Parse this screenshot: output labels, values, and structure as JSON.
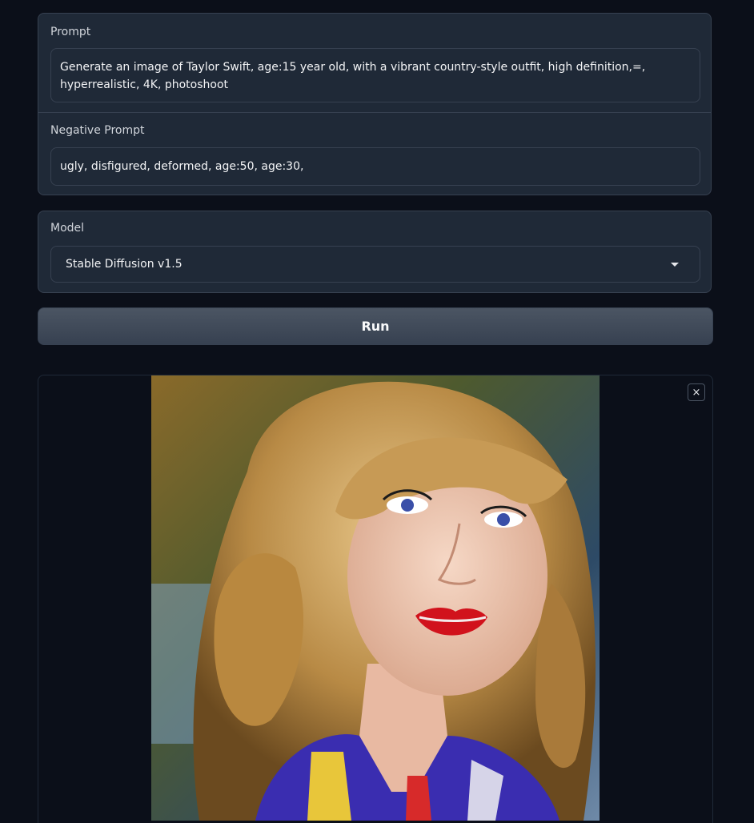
{
  "prompt": {
    "label": "Prompt",
    "value": "Generate an image of Taylor Swift, age:15 year old, with a vibrant country-style outfit, high definition,=, hyperrealistic, 4K, photoshoot"
  },
  "negative_prompt": {
    "label": "Negative Prompt",
    "value": "ugly, disfigured, deformed, age:50, age:30,"
  },
  "model": {
    "label": "Model",
    "selected": "Stable Diffusion v1.5"
  },
  "run_button": {
    "label": "Run"
  },
  "output": {
    "close_icon": "×"
  },
  "colors": {
    "background": "#0b0f19",
    "panel": "#1f2937",
    "border": "#374151",
    "button": "#4b5563"
  }
}
